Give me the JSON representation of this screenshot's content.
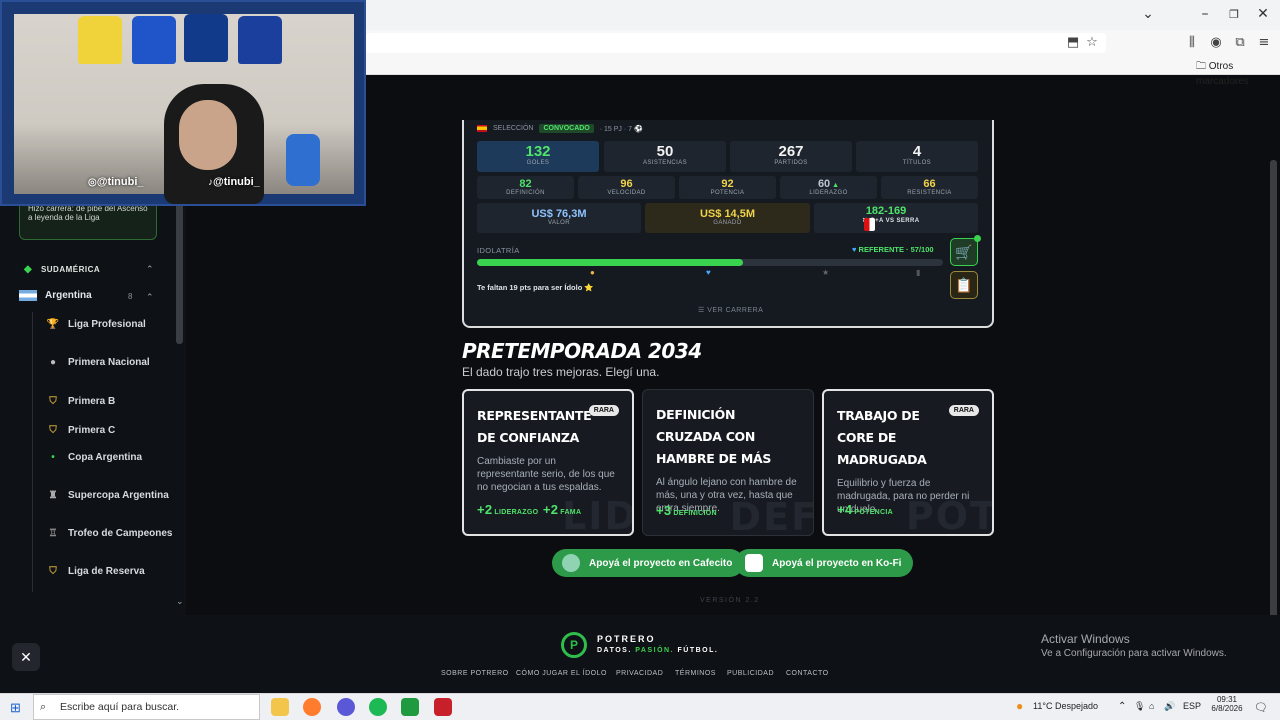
{
  "browser": {
    "bookmark_other": "Otros marcadores",
    "icons": [
      "chevron-down-icon",
      "minimize-icon",
      "restore-icon",
      "close-icon",
      "save-page-icon",
      "star-icon",
      "library-icon",
      "account-icon",
      "extensions-icon",
      "menu-icon"
    ]
  },
  "webcam": {
    "handle_instagram": "@tinubi_",
    "handle_tiktok": "@tinubi_"
  },
  "sidebar": {
    "promo_text": "Hizo carrera: de pibe del Ascenso a leyenda de la Liga",
    "region": "SUDAMÉRICA",
    "country": "Argentina",
    "country_count": "8",
    "items": [
      {
        "label": "Liga Profesional"
      },
      {
        "label": "Primera Nacional"
      },
      {
        "label": "Primera B"
      },
      {
        "label": "Primera C"
      },
      {
        "label": "Copa Argentina"
      },
      {
        "label": "Supercopa Argentina"
      },
      {
        "label": "Trofeo de Campeones"
      },
      {
        "label": "Liga de Reserva"
      }
    ]
  },
  "card": {
    "header_left": "SELECCIÓN",
    "header_badge": "CONVOCADO",
    "header_right": "· 15 PJ · 7 ⚽",
    "stats_main": [
      {
        "value": "132",
        "label": "GOLES"
      },
      {
        "value": "50",
        "label": "ASISTENCIAS"
      },
      {
        "value": "267",
        "label": "PARTIDOS"
      },
      {
        "value": "4",
        "label": "TÍTULOS"
      }
    ],
    "attributes": [
      {
        "value": "82",
        "label": "DEFINICIÓN"
      },
      {
        "value": "96",
        "label": "VELOCIDAD"
      },
      {
        "value": "92",
        "label": "POTENCIA"
      },
      {
        "value": "60",
        "label": "LIDERAZGO"
      },
      {
        "value": "66",
        "label": "RESISTENCIA"
      }
    ],
    "money": [
      {
        "value": "US$ 76,3M",
        "label": "VALOR"
      },
      {
        "value": "US$ 14,5M",
        "label": "GANADO"
      }
    ],
    "derby_value": "182-169",
    "derby_label": "G+A VS SERRA",
    "idolatry_label": "IDOLATRÍA",
    "idolatry_status": "REFERENTE · 57/100",
    "idolatry_progress": 0.57,
    "idolatry_hint": "Te faltan 19 pts para ser Ídolo ⭐",
    "career_link": "VER CARRERA"
  },
  "preseason": {
    "title": "PRETEMPORADA 2034",
    "subtitle": "El dado trajo tres mejoras. Elegí una.",
    "options": [
      {
        "title": "REPRESENTANTE DE CONFIANZA",
        "badge": "RARA",
        "desc": "Cambiaste por un representante serio, de los que no negocian a tus espaldas.",
        "bonus1_val": "+2",
        "bonus1_lbl": "LIDERAZGO",
        "bonus2_val": "+2",
        "bonus2_lbl": "FAMA",
        "bg": "LID"
      },
      {
        "title": "DEFINICIÓN CRUZADA CON HAMBRE DE MÁS",
        "badge": "",
        "desc": "Al ángulo lejano con hambre de más, una y otra vez, hasta que entra siempre.",
        "bonus1_val": "+3",
        "bonus1_lbl": "DEFINICIÓN",
        "bg": "DEF"
      },
      {
        "title": "TRABAJO DE CORE DE MADRUGADA",
        "badge": "RARA",
        "desc": "Equilibrio y fuerza de madrugada, para no perder ni un duelo.",
        "bonus1_val": "+4",
        "bonus1_lbl": "POTENCIA",
        "bg": "POT"
      }
    ]
  },
  "donate": {
    "cafecito": "Apoyá el proyecto en Cafecito",
    "kofi": "Apoyá el proyecto en Ko-Fi"
  },
  "version": "VERSIÓN 2.2",
  "footer": {
    "brand": "POTRERO",
    "tag_1": "DATOS.",
    "tag_2": "PASIÓN.",
    "tag_3": "FÚTBOL.",
    "links": [
      "SOBRE POTRERO",
      "CÓMO JUGAR EL ÍDOLO",
      "PRIVACIDAD",
      "TÉRMINOS",
      "PUBLICIDAD",
      "CONTACTO"
    ]
  },
  "windows_activation": {
    "line1": "Activar Windows",
    "line2": "Ve a Configuración para activar Windows."
  },
  "taskbar": {
    "search_placeholder": "Escribe aquí para buscar.",
    "weather": "11°C  Despejado",
    "lang": "ESP",
    "time": "09:31",
    "date": "6/8/2026"
  },
  "colors": {
    "accent_green": "#3ad34f",
    "gold": "#f0d34a"
  }
}
